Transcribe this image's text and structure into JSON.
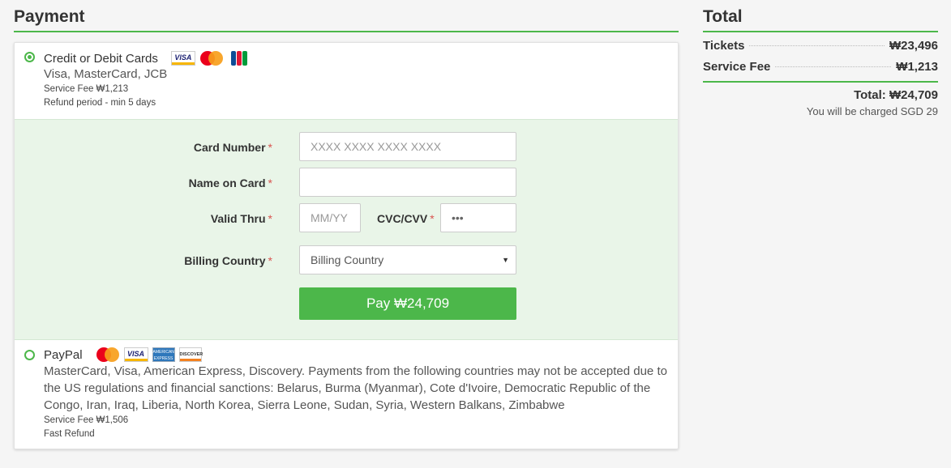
{
  "payment": {
    "heading": "Payment",
    "card_method": {
      "name": "Credit or Debit Cards",
      "networks": "Visa, MasterCard, JCB",
      "service_fee": "Service Fee ₩1,213",
      "refund": "Refund period - min 5 days",
      "logos": [
        "visa-logo",
        "mastercard-logo",
        "jcb-logo"
      ]
    },
    "form": {
      "card_number_label": "Card Number",
      "card_number_placeholder": "XXXX XXXX XXXX XXXX",
      "name_label": "Name on Card",
      "name_value": "",
      "valid_label": "Valid Thru",
      "valid_placeholder": "MM/YY",
      "cvc_label": "CVC/CVV",
      "cvc_placeholder": "•••",
      "country_label": "Billing Country",
      "country_selected": "Billing Country",
      "required_mark": "*",
      "pay_button": "Pay ₩24,709"
    },
    "paypal_method": {
      "name": "PayPal",
      "networks": "MasterCard, Visa, American Express, Discovery. Payments from the following countries may not be accepted due to the US regulations and financial sanctions: Belarus, Burma (Myanmar), Cote d'Ivoire, Democratic Republic of the Congo, Iran, Iraq, Liberia, North Korea, Sierra Leone, Sudan, Syria, Western Balkans, Zimbabwe",
      "service_fee": "Service Fee ₩1,506",
      "refund": "Fast Refund",
      "logos": [
        "mastercard-logo",
        "visa-logo",
        "amex-logo",
        "discover-logo"
      ]
    }
  },
  "total": {
    "heading": "Total",
    "tickets_label": "Tickets",
    "tickets_value": "₩23,496",
    "fee_label": "Service Fee",
    "fee_value": "₩1,213",
    "total_line": "Total: ₩24,709",
    "charged_line": "You will be charged SGD 29"
  },
  "colors": {
    "accent": "#4cb74a",
    "form_bg": "#e9f5e8",
    "required": "#d9534f"
  }
}
